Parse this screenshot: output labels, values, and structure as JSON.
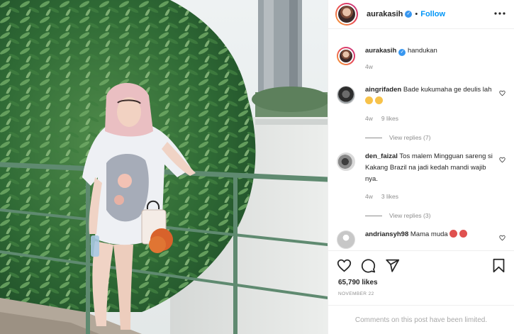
{
  "post": {
    "author": "aurakasih",
    "follow_label": "Follow",
    "separator": "•",
    "caption_text": "handukan",
    "caption_age": "4w",
    "likes": "65,790 likes",
    "date": "NOVEMBER 22",
    "comments_limited": "Comments on this post have been limited."
  },
  "comments": [
    {
      "user": "aingrifaden",
      "text": "Bade kukumaha ge deulis lah",
      "age": "4w",
      "likes": "9 likes",
      "replies": "View replies (7)"
    },
    {
      "user": "den_faizal",
      "text": "Tos malem Mingguan sareng si Kakang Brazil na jadi kedah mandi wajib nya.",
      "age": "4w",
      "likes": "3 likes",
      "replies": "View replies (3)"
    },
    {
      "user": "andriansyh98",
      "text": "Mama muda"
    }
  ],
  "icons": {
    "more": "more-horizontal-icon",
    "verified": "verified-badge-icon",
    "like": "heart-icon",
    "comment": "comment-icon",
    "share": "paper-plane-icon",
    "save": "bookmark-icon"
  },
  "colors": {
    "link": "#0095f6",
    "verified": "#3897f0",
    "muted": "#8e8e8e",
    "railing": "#5f8a70"
  }
}
